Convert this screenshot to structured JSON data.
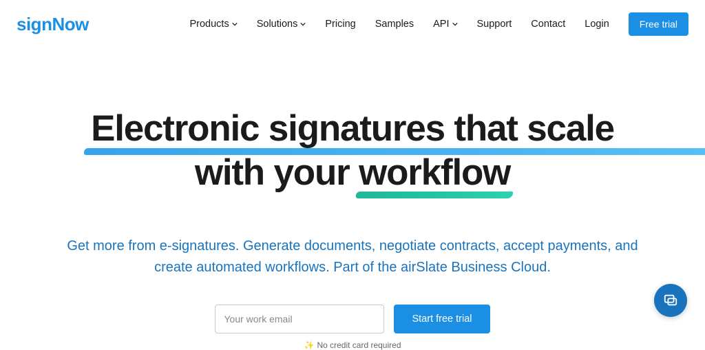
{
  "brand": "signNow",
  "nav": {
    "items": [
      {
        "label": "Products",
        "dropdown": true
      },
      {
        "label": "Solutions",
        "dropdown": true
      },
      {
        "label": "Pricing",
        "dropdown": false
      },
      {
        "label": "Samples",
        "dropdown": false
      },
      {
        "label": "API",
        "dropdown": true
      },
      {
        "label": "Support",
        "dropdown": false
      },
      {
        "label": "Contact",
        "dropdown": false
      },
      {
        "label": "Login",
        "dropdown": false
      }
    ],
    "cta": "Free trial"
  },
  "hero": {
    "line1_prefix": "Electronic",
    "line1_rest": " signatures that scale",
    "line2_prefix": "with your ",
    "line2_highlight": "workflow",
    "subtitle": "Get more from e-signatures. Generate documents, negotiate contracts, accept payments, and create automated workflows. Part of the airSlate Business Cloud."
  },
  "trial": {
    "placeholder": "Your work email",
    "button": "Start free trial",
    "footnote": "No credit card required"
  },
  "chat": {
    "icon": "chat-icon"
  }
}
